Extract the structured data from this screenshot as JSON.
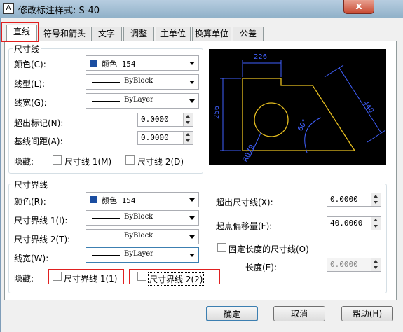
{
  "window": {
    "title": "修改标注样式: S-40",
    "icon": "A",
    "close": "x"
  },
  "tabs": [
    {
      "label": "直线"
    },
    {
      "label": "符号和箭头"
    },
    {
      "label": "文字"
    },
    {
      "label": "调整"
    },
    {
      "label": "主单位"
    },
    {
      "label": "换算单位"
    },
    {
      "label": "公差"
    }
  ],
  "dim_line": {
    "title": "尺寸线",
    "color_label": "颜色(C):",
    "color_value": "颜色 154",
    "linetype_label": "线型(L):",
    "linetype_value": "ByBlock",
    "lineweight_label": "线宽(G):",
    "lineweight_value": "ByLayer",
    "extend_ticks_label": "超出标记(N):",
    "extend_ticks_value": "0.0000",
    "baseline_label": "基线间距(A):",
    "baseline_value": "0.0000",
    "suppress_label": "隐藏:",
    "suppress_1": "尺寸线 1(M)",
    "suppress_2": "尺寸线 2(D)"
  },
  "ext_line": {
    "title": "尺寸界线",
    "color_label": "颜色(R):",
    "color_value": "颜色 154",
    "linetype1_label": "尺寸界线 1(I):",
    "linetype1_value": "ByBlock",
    "linetype2_label": "尺寸界线 2(T):",
    "linetype2_value": "ByBlock",
    "lineweight_label": "线宽(W):",
    "lineweight_value": "ByLayer",
    "suppress_label": "隐藏:",
    "suppress_1": "尺寸界线 1(1)",
    "suppress_2": "尺寸界线 2(2)",
    "extend_label": "超出尺寸线(X):",
    "extend_value": "0.0000",
    "offset_label": "起点偏移量(F):",
    "offset_value": "40.0000",
    "fixed_label": "固定长度的尺寸线(O)",
    "length_label": "长度(E):",
    "length_value": "0.0000"
  },
  "preview": {
    "dim_top": "226",
    "dim_left": "256",
    "dim_right": "440",
    "dim_angle": "60°",
    "dim_radius": "R079"
  },
  "buttons": {
    "ok": "确定",
    "cancel": "取消",
    "help": "帮助(H)"
  },
  "colors": {
    "accent_red": "#e02020",
    "preview_bg": "#000000",
    "shape_yellow": "#e8c020",
    "dim_blue": "#4060ff",
    "swatch_blue": "#1a4da0"
  }
}
